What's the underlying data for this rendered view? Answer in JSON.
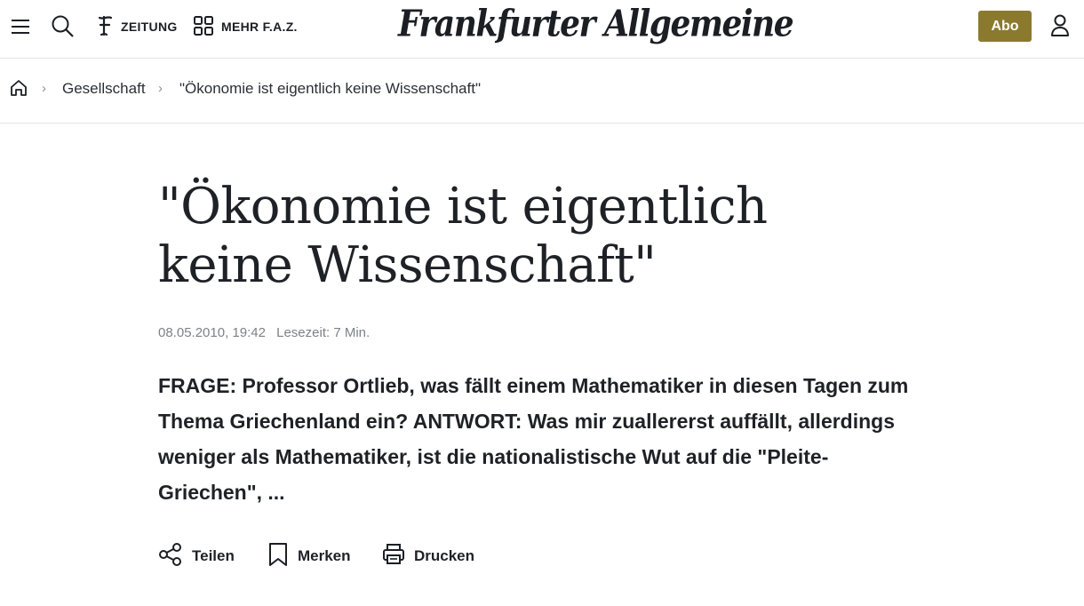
{
  "header": {
    "nav": [
      {
        "label": "ZEITUNG",
        "icon": "faz-f-icon"
      },
      {
        "label": "MEHR F.A.Z.",
        "icon": "grid-icon"
      }
    ],
    "logo_text": "Frankfurter Allgemeine",
    "abo_label": "Abo",
    "accent_color": "#8b7a2e"
  },
  "breadcrumb": {
    "home_icon": "home-icon",
    "items": [
      "Gesellschaft",
      "\"Ökonomie ist eigentlich keine Wissenschaft\""
    ],
    "separator": "›"
  },
  "article": {
    "title": "\"Ökonomie ist eigentlich keine Wissenschaft\"",
    "date": "08.05.2010, 19:42",
    "reading_time": "Lesezeit: 7 Min.",
    "teaser": "FRAGE: Professor Ortlieb, was fällt einem Mathematiker in diesen Tagen zum Thema Griechenland ein? ANTWORT: Was mir zuallererst auffällt, allerdings weniger als Mathematiker, ist die nationalistische Wut auf die \"Pleite-Griechen\", ...",
    "actions": [
      {
        "label": "Teilen",
        "icon": "share-icon"
      },
      {
        "label": "Merken",
        "icon": "bookmark-icon"
      },
      {
        "label": "Drucken",
        "icon": "print-icon"
      }
    ]
  }
}
